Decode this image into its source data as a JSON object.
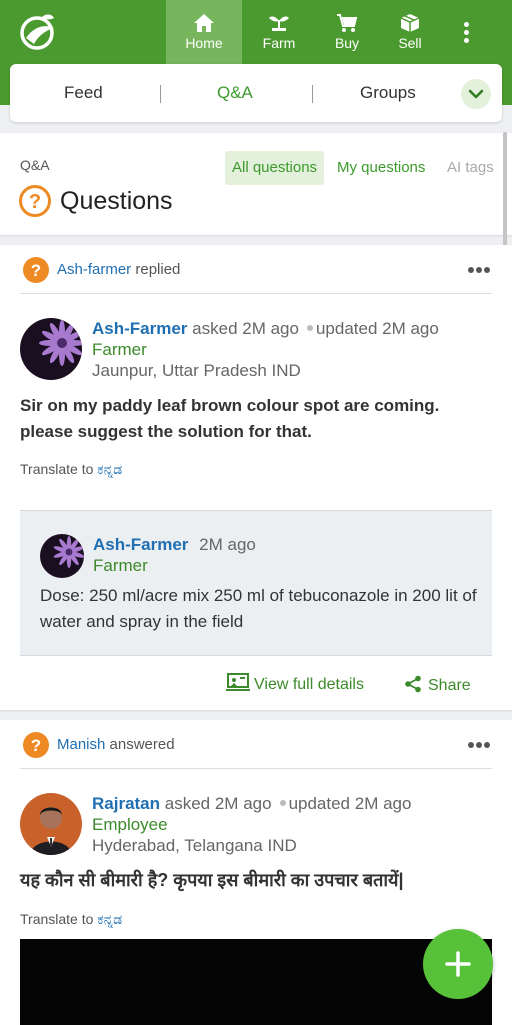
{
  "nav": {
    "items": [
      {
        "label": "Home",
        "icon": "home-icon"
      },
      {
        "label": "Farm",
        "icon": "plant-icon"
      },
      {
        "label": "Buy",
        "icon": "cart-icon"
      },
      {
        "label": "Sell",
        "icon": "box-icon"
      }
    ],
    "active": "Home"
  },
  "tabs": {
    "items": [
      "Feed",
      "Q&A",
      "Groups"
    ],
    "active": "Q&A",
    "separator": "|"
  },
  "questions_header": {
    "section_label": "Q&A",
    "title": "Questions",
    "filters": [
      "All questions",
      "My questions",
      "AI tags"
    ]
  },
  "posts": [
    {
      "activity_user": "Ash-farmer",
      "activity_action": "replied",
      "author": "Ash-Farmer",
      "asked_text": "asked 2M ago",
      "updated_text": "updated 2M ago",
      "role": "Farmer",
      "location": "Jaunpur, Uttar Pradesh IND",
      "question": "Sir on my paddy leaf brown colour spot are coming. please suggest the solution for that.",
      "translate_label": "Translate to",
      "translate_lang": "ಕನ್ನಡ",
      "reply": {
        "author": "Ash-Farmer",
        "time": "2M ago",
        "role": "Farmer",
        "text": "Dose: 250 ml/acre mix 250 ml of tebuconazole in 200 lit of water and spray in the field"
      },
      "view_details_label": "View full details",
      "share_label": "Share"
    },
    {
      "activity_user": "Manish",
      "activity_action": "answered",
      "author": "Rajratan",
      "asked_text": "asked 2M ago",
      "updated_text": "updated 2M ago",
      "role": "Employee",
      "location": "Hyderabad, Telangana IND",
      "question": "यह कौन सी बीमारी है? कृपया इस बीमारी का उपचार बतायें|",
      "translate_label": "Translate to",
      "translate_lang": "ಕನ್ನಡ"
    }
  ],
  "colors": {
    "brand_green": "#4b9a2f",
    "active_nav": "#78b65e",
    "link_blue": "#1f6fb2",
    "accent_orange": "#ee8a23",
    "fab_green": "#58c13a"
  }
}
